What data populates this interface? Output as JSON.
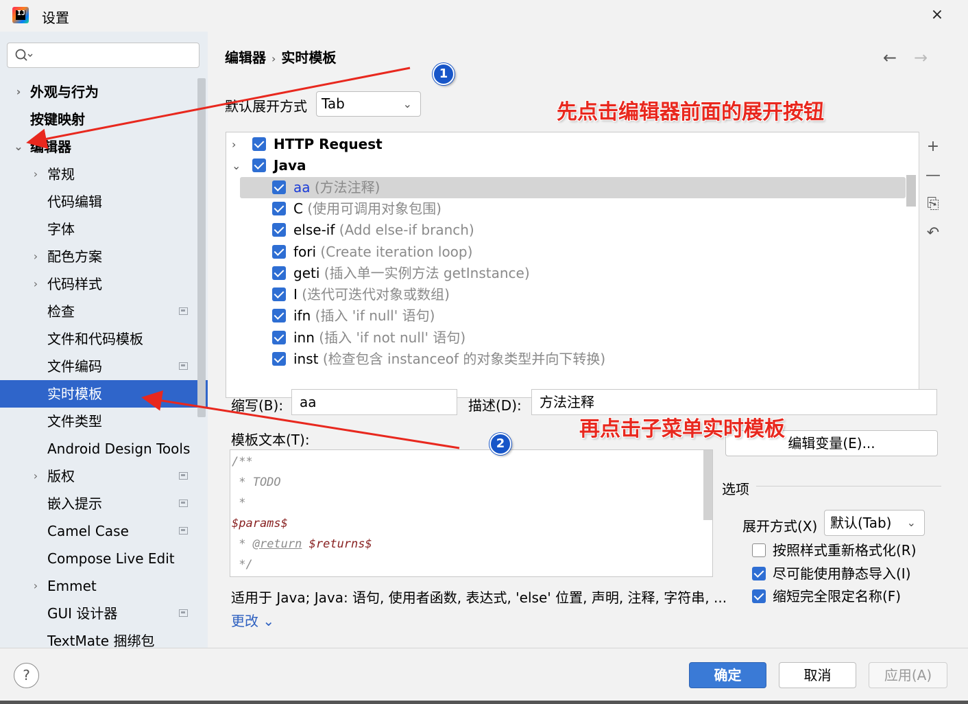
{
  "window": {
    "title": "设置",
    "close_icon": "×"
  },
  "sidebar": {
    "search_placeholder": "",
    "items": [
      {
        "label": "外观与行为",
        "bold": true,
        "chevron": "›"
      },
      {
        "label": "按键映射",
        "bold": true
      },
      {
        "label": "编辑器",
        "bold": true,
        "chevron": "⌄"
      },
      {
        "label": "常规",
        "chevron": "›"
      },
      {
        "label": "代码编辑"
      },
      {
        "label": "字体"
      },
      {
        "label": "配色方案",
        "chevron": "›"
      },
      {
        "label": "代码样式",
        "chevron": "›"
      },
      {
        "label": "检查",
        "page_icon": true
      },
      {
        "label": "文件和代码模板"
      },
      {
        "label": "文件编码",
        "page_icon": true
      },
      {
        "label": "实时模板",
        "selected": true
      },
      {
        "label": "文件类型"
      },
      {
        "label": "Android Design Tools"
      },
      {
        "label": "版权",
        "chevron": "›",
        "page_icon": true
      },
      {
        "label": "嵌入提示",
        "page_icon": true
      },
      {
        "label": "Camel Case",
        "page_icon": true
      },
      {
        "label": "Compose Live Edit"
      },
      {
        "label": "Emmet",
        "chevron": "›"
      },
      {
        "label": "GUI 设计器",
        "page_icon": true
      },
      {
        "label": "TextMate 捆绑包"
      }
    ]
  },
  "main": {
    "breadcrumb": [
      "编辑器",
      "实时模板"
    ],
    "breadcrumb_sep": "›",
    "nav_back": "←",
    "nav_forward": "→",
    "expand_label": "默认展开方式",
    "expand_value": "Tab",
    "templates": [
      {
        "name": "HTTP Request",
        "group": true,
        "chevron": "›"
      },
      {
        "name": "Java",
        "group": true,
        "chevron": "⌄"
      },
      {
        "name": "aa",
        "desc": " (方法注释)",
        "selected": true
      },
      {
        "name": "C",
        "desc": " (使用可调用对象包围)"
      },
      {
        "name": "else-if",
        "desc": " (Add else-if branch)"
      },
      {
        "name": "fori",
        "desc": " (Create iteration loop)"
      },
      {
        "name": "geti",
        "desc": " (插入单一实例方法 getInstance)"
      },
      {
        "name": "I",
        "desc": " (迭代可迭代对象或数组)"
      },
      {
        "name": "ifn",
        "desc": " (插入 'if null' 语句)"
      },
      {
        "name": "inn",
        "desc": " (插入 'if not null' 语句)"
      },
      {
        "name": "inst",
        "desc": " (检查包含 instanceof 的对象类型并向下转换)"
      }
    ],
    "tools": {
      "add": "+",
      "remove": "—",
      "copy": "⎘",
      "revert": "↶"
    },
    "abbreviation_label": "缩写(B):",
    "abbreviation_value": "aa",
    "description_label": "描述(D):",
    "description_value": "方法注释",
    "template_text_label": "模板文本(T):",
    "template_lines": [
      "/**",
      " * TODO",
      " *",
      "$params$",
      " * @return $returns$",
      " */"
    ],
    "edit_vars_button": "编辑变量(E)...",
    "options_label": "选项",
    "expand_with_label": "展开方式(X)",
    "expand_with_value": "默认(Tab)",
    "options": [
      {
        "label": "按照样式重新格式化(R)",
        "checked": false
      },
      {
        "label": "尽可能使用静态导入(I)",
        "checked": true
      },
      {
        "label": "缩短完全限定名称(F)",
        "checked": true
      }
    ],
    "context_text": "适用于 Java; Java: 语句, 使用者函数, 表达式, 'else' 位置, 声明, 注释, 字符串, ...",
    "change_link": "更改 ⌄"
  },
  "footer": {
    "help": "?",
    "ok": "确定",
    "cancel": "取消",
    "apply": "应用(A)"
  },
  "annotations": {
    "text1": "先点击编辑器前面的展开按钮",
    "text2": "再点击子菜单实时模板",
    "badge1": "1",
    "badge2": "2",
    "arrow_color": "#e8281e"
  }
}
